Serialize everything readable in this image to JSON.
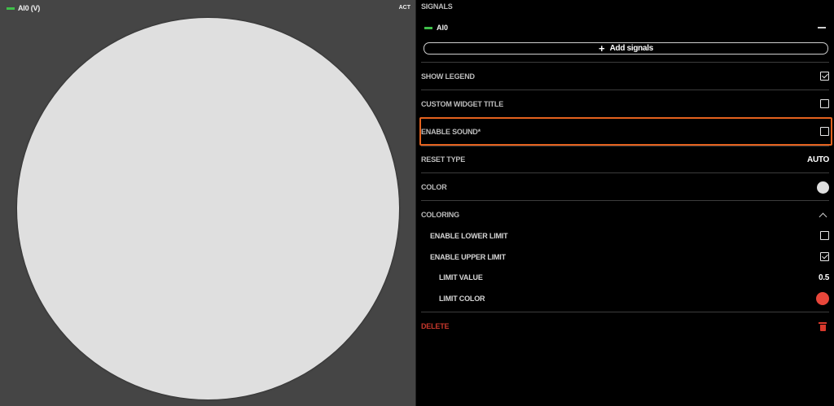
{
  "widget": {
    "legend_label": "AI0 (V)",
    "status": "ACT",
    "legend_color": "#3fbf4a",
    "lamp_color": "#dfdfdf"
  },
  "panel": {
    "signals_header": "SIGNALS",
    "signal": {
      "name": "AI0",
      "color": "#3fbf4a"
    },
    "add_signals_label": "Add signals",
    "show_legend": {
      "label": "SHOW LEGEND",
      "checked": true
    },
    "custom_title": {
      "label": "CUSTOM WIDGET TITLE",
      "checked": false
    },
    "enable_sound": {
      "label": "ENABLE SOUND*",
      "checked": false
    },
    "reset_type": {
      "label": "RESET TYPE",
      "value": "AUTO"
    },
    "color": {
      "label": "COLOR",
      "value": "#dfdfdf"
    },
    "coloring": {
      "label": "COLORING",
      "enable_lower_limit": {
        "label": "ENABLE LOWER LIMIT",
        "checked": false
      },
      "enable_upper_limit": {
        "label": "ENABLE UPPER LIMIT",
        "checked": true
      },
      "limit_value": {
        "label": "LIMIT VALUE",
        "value": "0.5"
      },
      "limit_color": {
        "label": "LIMIT COLOR",
        "value": "#e8463a"
      }
    },
    "delete_label": "DELETE",
    "highlight_color": "#e4621e"
  }
}
